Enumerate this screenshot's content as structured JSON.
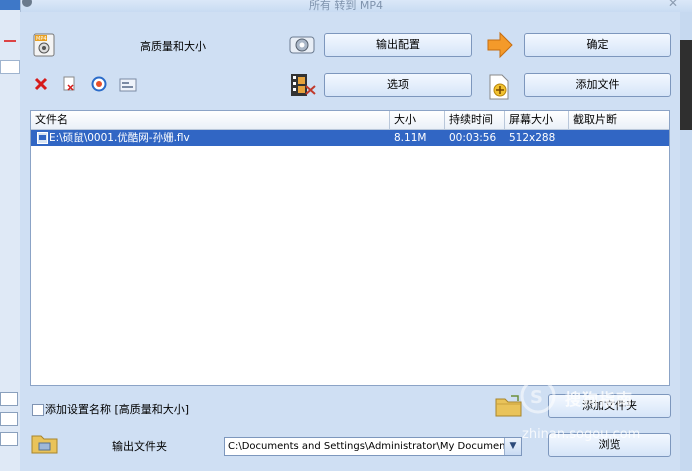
{
  "window": {
    "title": "所有 转到 MP4"
  },
  "toolbar": {
    "quality_label": "高质量和大小",
    "output_config_label": "输出配置",
    "ok_label": "确定",
    "options_label": "选项",
    "add_file_label": "添加文件"
  },
  "file_list": {
    "columns": [
      "文件名",
      "大小",
      "持续时间",
      "屏幕大小",
      "截取片断"
    ],
    "rows": [
      {
        "name": "E:\\硕鼠\\0001.优酷网-孙姗.flv",
        "size": "8.11M",
        "duration": "00:03:56",
        "screen": "512x288",
        "clip": ""
      }
    ]
  },
  "bottom": {
    "add_setting_label": "添加设置名称 [高质量和大小]",
    "add_folder_label": "添加文件夹",
    "output_folder_label": "输出文件夹",
    "output_path": "C:\\Documents and Settings\\Administrator\\My Documents\\FFO",
    "browse_label": "浏览"
  },
  "watermark": {
    "line1": "搜狗指南",
    "line2": "zhinan.sogou.com"
  },
  "icons": [
    "mp4-device-icon",
    "delete-icon",
    "clear-icon",
    "play-icon",
    "info-icon",
    "settings-gear-icon",
    "arrow-right-icon",
    "video-clip-icon",
    "add-document-icon",
    "folder-icon",
    "folder-open-icon",
    "chevron-down-icon"
  ]
}
